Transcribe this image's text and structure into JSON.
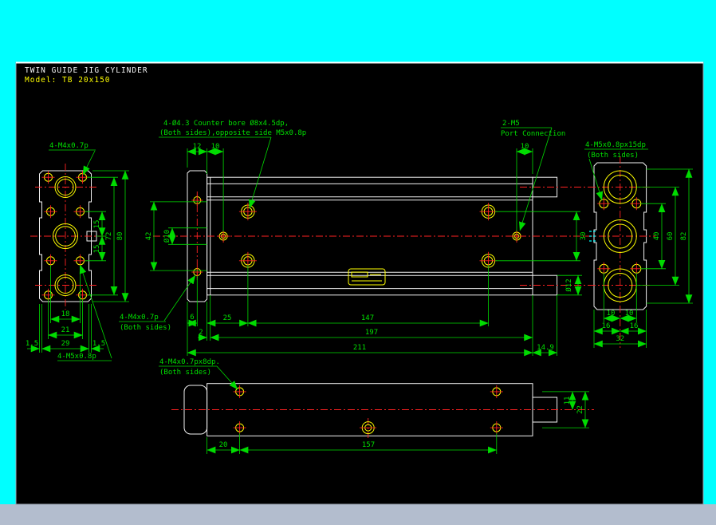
{
  "title": {
    "product": "TWIN GUIDE JIG CYLINDER",
    "model": "Model: TB 20x150"
  },
  "notes": {
    "m4_endview": "4-M4x0.7p",
    "counterbore_l1": "4-Ø4.3 Counter bore Ø8x4.5dp,",
    "counterbore_l2": "(Both sides),opposite side M5x0.8p",
    "port_l1": "2-M5",
    "port_l2": "Port Connection",
    "m5_right_l1": "4-M5x0.8px15dp",
    "m5_right_l2": "(Both sides)",
    "m4_front_l1": "4-M4x0.7p",
    "m4_front_l2": "(Both sides)",
    "m5_endview": "4-M5x0.8p",
    "m4_bottom_l1": "4-M4x0.7px8dp.",
    "m4_bottom_l2": "(Both sides)"
  },
  "dims": {
    "left": {
      "s15a": "15",
      "s15b": "15",
      "v72": "72",
      "v80": "80",
      "h18": "18",
      "h21": "21",
      "h29": "29",
      "lip_l": "1.5",
      "lip_r": "1.5"
    },
    "front": {
      "t12": "12",
      "t10_left": "10",
      "t10_right": "10",
      "v42": "42",
      "d10": "Ø10",
      "v30": "30",
      "d12": "Ø12",
      "b6": "6",
      "b25": "25",
      "b147": "147",
      "b2": "2",
      "b197": "197",
      "b211": "211",
      "b14_9": "14.9"
    },
    "right": {
      "v40": "40",
      "v60": "60",
      "v82": "82",
      "h10a": "10",
      "h10b": "10",
      "h16a": "16",
      "h16b": "16",
      "h32": "32"
    },
    "bottom": {
      "h20": "20",
      "h157": "157",
      "v11": "11",
      "v22": "22"
    }
  },
  "colors": {
    "background": "#00FFFF",
    "canvas": "#000000",
    "geometry": "#F2F2F2",
    "dimension": "#00DB00",
    "centerline": "#FF2222",
    "hole": "#FFFF00",
    "bottom_strip": "#B3BDCE"
  }
}
